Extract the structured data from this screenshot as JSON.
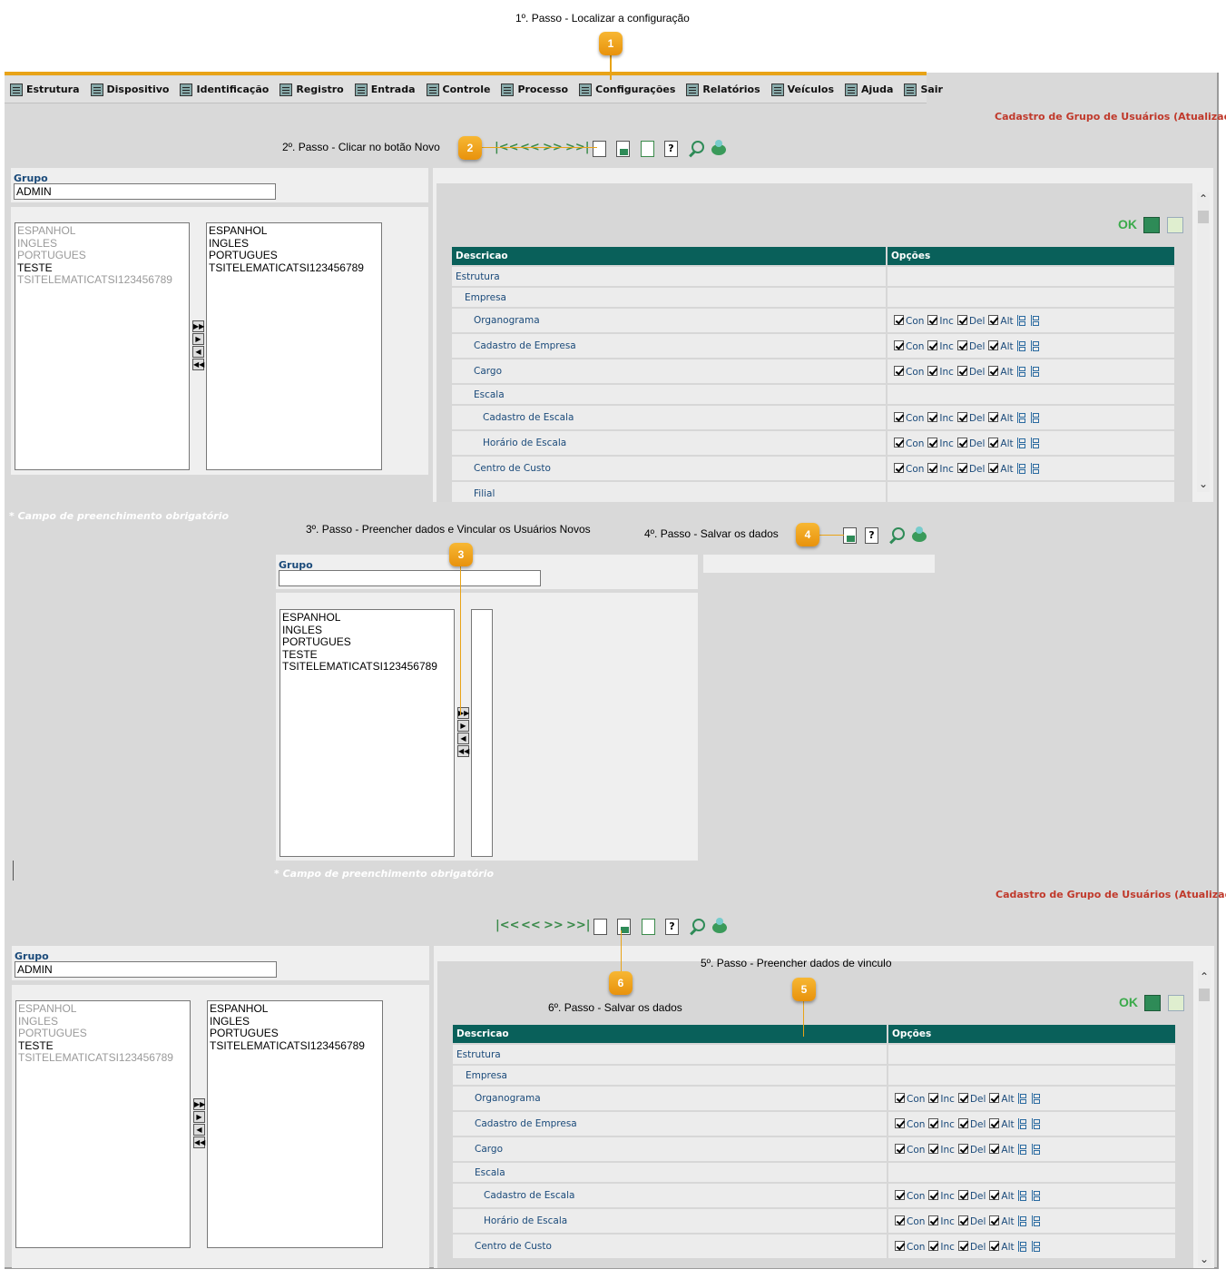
{
  "steps": {
    "s1": "1º. Passo - Localizar a configuração",
    "s2": "2º. Passo - Clicar no botão Novo",
    "s3": "3º. Passo - Preencher dados e Vincular os Usuários Novos",
    "s4": "4º. Passo - Salvar os dados",
    "s5": "5º. Passo - Preencher dados de vinculo",
    "s6": "6º. Passo - Salvar os dados"
  },
  "badges": {
    "b1": "1",
    "b2": "2",
    "b3": "3",
    "b4": "4",
    "b5": "5",
    "b6": "6"
  },
  "menu": [
    {
      "label": "Estrutura",
      "icon": "structure-icon"
    },
    {
      "label": "Dispositivo",
      "icon": "device-icon"
    },
    {
      "label": "Identificação",
      "icon": "identification-icon"
    },
    {
      "label": "Registro",
      "icon": "register-icon"
    },
    {
      "label": "Entrada",
      "icon": "entry-icon"
    },
    {
      "label": "Controle",
      "icon": "control-icon"
    },
    {
      "label": "Processo",
      "icon": "process-icon"
    },
    {
      "label": "Configurações",
      "icon": "settings-icon"
    },
    {
      "label": "Relatórios",
      "icon": "reports-icon"
    },
    {
      "label": "Veículos",
      "icon": "vehicles-icon"
    },
    {
      "label": "Ajuda",
      "icon": "help-icon"
    },
    {
      "label": "Sair",
      "icon": "exit-icon"
    }
  ],
  "form_title": "Cadastro de Grupo de Usuários (Atualização)",
  "nav": {
    "first": "|<<",
    "prev": "<<",
    "next": ">>",
    "last": ">>|"
  },
  "group": {
    "label": "Grupo",
    "value": "ADMIN",
    "required": "*",
    "empty_value": ""
  },
  "required_note": "* Campo de preenchimento obrigatório",
  "available_users": [
    {
      "name": "ESPANHOL",
      "active": false
    },
    {
      "name": "INGLES",
      "active": false
    },
    {
      "name": "PORTUGUES",
      "active": false
    },
    {
      "name": "TESTE",
      "active": true
    },
    {
      "name": "TSITELEMATICATSI123456789",
      "active": false
    }
  ],
  "linked_users": [
    "ESPANHOL",
    "INGLES",
    "PORTUGUES",
    "TSITELEMATICATSI123456789"
  ],
  "new_available_users": [
    "ESPANHOL",
    "INGLES",
    "PORTUGUES",
    "TESTE",
    "TSITELEMATICATSI123456789"
  ],
  "mover_buttons": [
    "▶▶",
    "▶",
    "◀",
    "◀◀"
  ],
  "ok_label": "OK",
  "grid": {
    "col_desc": "Descricao",
    "col_opts": "Opções",
    "opt_labels": [
      "Con",
      "Inc",
      "Del",
      "Alt"
    ],
    "rows": [
      {
        "label": "Estrutura",
        "level": 0,
        "opts": false
      },
      {
        "label": "Empresa",
        "level": 1,
        "opts": false
      },
      {
        "label": "Organograma",
        "level": 2,
        "opts": true
      },
      {
        "label": "Cadastro de Empresa",
        "level": 2,
        "opts": true
      },
      {
        "label": "Cargo",
        "level": 2,
        "opts": true
      },
      {
        "label": "Escala",
        "level": 2,
        "opts": false
      },
      {
        "label": "Cadastro de Escala",
        "level": 3,
        "opts": true
      },
      {
        "label": "Horário de Escala",
        "level": 3,
        "opts": true
      },
      {
        "label": "Centro de Custo",
        "level": 2,
        "opts": true
      }
    ],
    "cut_row": "Filial"
  }
}
